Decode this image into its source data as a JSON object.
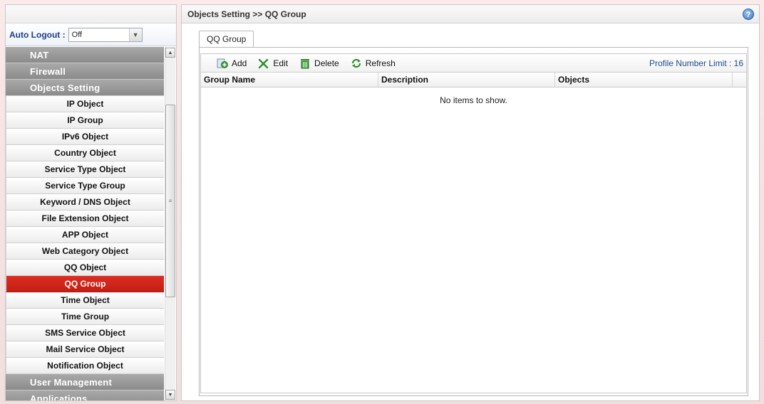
{
  "sidebar": {
    "auto_logout": {
      "label": "Auto Logout :",
      "value": "Off"
    },
    "menu": [
      {
        "type": "category",
        "label": "NAT"
      },
      {
        "type": "category",
        "label": "Firewall"
      },
      {
        "type": "category",
        "label": "Objects Setting"
      },
      {
        "type": "item",
        "label": "IP Object"
      },
      {
        "type": "item",
        "label": "IP Group"
      },
      {
        "type": "item",
        "label": "IPv6 Object"
      },
      {
        "type": "item",
        "label": "Country Object"
      },
      {
        "type": "item",
        "label": "Service Type Object"
      },
      {
        "type": "item",
        "label": "Service Type Group"
      },
      {
        "type": "item",
        "label": "Keyword / DNS Object"
      },
      {
        "type": "item",
        "label": "File Extension Object"
      },
      {
        "type": "item",
        "label": "APP Object"
      },
      {
        "type": "item",
        "label": "Web Category Object"
      },
      {
        "type": "item",
        "label": "QQ Object"
      },
      {
        "type": "item",
        "label": "QQ Group",
        "active": true
      },
      {
        "type": "item",
        "label": "Time Object"
      },
      {
        "type": "item",
        "label": "Time Group"
      },
      {
        "type": "item",
        "label": "SMS Service Object"
      },
      {
        "type": "item",
        "label": "Mail Service Object"
      },
      {
        "type": "item",
        "label": "Notification Object"
      },
      {
        "type": "category",
        "label": "User Management"
      },
      {
        "type": "category",
        "label": "Applications"
      }
    ]
  },
  "main": {
    "breadcrumb": "Objects Setting >> QQ Group",
    "help_icon": "help-icon",
    "tab": "QQ Group",
    "toolbar": {
      "add": "Add",
      "edit": "Edit",
      "delete": "Delete",
      "refresh": "Refresh",
      "profile_limit": "Profile Number Limit : 16"
    },
    "columns": [
      "Group Name",
      "Description",
      "Objects"
    ],
    "empty_message": "No items to show."
  },
  "colors": {
    "active_item": "#cc2318",
    "category_bg": "#999999",
    "link_blue": "#1d3e86"
  }
}
